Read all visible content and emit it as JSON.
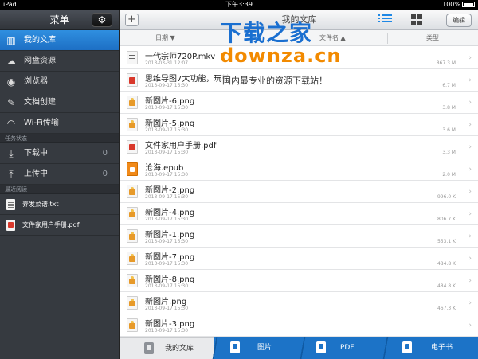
{
  "status": {
    "device": "iPad",
    "time": "下午3:39",
    "battery": "100%"
  },
  "sidebar": {
    "title": "菜单",
    "items": [
      {
        "label": "我的文库",
        "icon": "library-icon",
        "active": true
      },
      {
        "label": "网盘资源",
        "icon": "cloud-icon"
      },
      {
        "label": "浏览器",
        "icon": "globe-icon"
      },
      {
        "label": "文档创建",
        "icon": "edit-doc-icon"
      },
      {
        "label": "Wi-Fi传输",
        "icon": "wifi-icon"
      }
    ],
    "task_section": "任务状态",
    "tasks": [
      {
        "label": "下载中",
        "count": "0",
        "icon": "download-icon"
      },
      {
        "label": "上传中",
        "count": "0",
        "icon": "upload-icon"
      }
    ],
    "recent_section": "最近阅读",
    "recent": [
      {
        "label": "养发菜谱.txt",
        "type": "txt"
      },
      {
        "label": "文件家用户手册.pdf",
        "type": "pdf"
      }
    ]
  },
  "toolbar": {
    "add": "+",
    "title": "我的文库",
    "edit": "编辑"
  },
  "columns": {
    "date": "日期",
    "name": "文件名",
    "type": "类型"
  },
  "files": [
    {
      "name": "一代宗师720P.mkv",
      "date": "2013-03-31 12:07",
      "size": "867.3 M",
      "type": "mkv"
    },
    {
      "name": "思维导图7大功能，玩转",
      "date": "2013-09-17 15:30",
      "size": "6.7 M",
      "type": "pdf"
    },
    {
      "name": "新图片-6.png",
      "date": "2013-09-17 15:30",
      "size": "3.8 M",
      "type": "png"
    },
    {
      "name": "新图片-5.png",
      "date": "2013-09-17 15:30",
      "size": "3.6 M",
      "type": "png"
    },
    {
      "name": "文件家用户手册.pdf",
      "date": "2013-09-17 15:30",
      "size": "3.3 M",
      "type": "pdf"
    },
    {
      "name": "沧海.epub",
      "date": "2013-09-17 15:30",
      "size": "2.0 M",
      "type": "epub"
    },
    {
      "name": "新图片-2.png",
      "date": "2013-09-17 15:30",
      "size": "996.0 K",
      "type": "png"
    },
    {
      "name": "新图片-4.png",
      "date": "2013-09-17 15:30",
      "size": "806.7 K",
      "type": "png"
    },
    {
      "name": "新图片-1.png",
      "date": "2013-09-17 15:30",
      "size": "553.1 K",
      "type": "png"
    },
    {
      "name": "新图片-7.png",
      "date": "2013-09-17 15:30",
      "size": "484.8 K",
      "type": "png"
    },
    {
      "name": "新图片-8.png",
      "date": "2013-09-17 15:30",
      "size": "484.8 K",
      "type": "png"
    },
    {
      "name": "新图片.png",
      "date": "2013-09-17 15:30",
      "size": "467.3 K",
      "type": "png"
    },
    {
      "name": "新图片-3.png",
      "date": "2013-09-17 15:30",
      "size": "",
      "type": "png"
    }
  ],
  "tabs": [
    {
      "label": "我的文库",
      "active": true
    },
    {
      "label": "图片"
    },
    {
      "label": "PDF"
    },
    {
      "label": "电子书"
    }
  ],
  "watermark": {
    "line1": "下载之家",
    "line2": "downza.cn",
    "line3": "国内最专业的资源下载站！"
  }
}
